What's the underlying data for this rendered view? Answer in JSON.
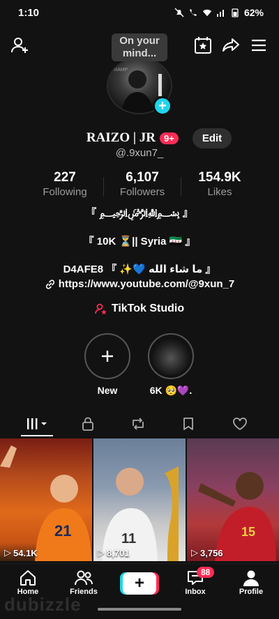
{
  "status": {
    "time": "1:10",
    "battery": "62%"
  },
  "topbar": {
    "mind_bubble": "On your mind..."
  },
  "profile": {
    "name": "RAIZO | JR",
    "name_badge": "9+",
    "edit_label": "Edit",
    "handle": "@.9xun7_"
  },
  "stats": [
    {
      "value": "227",
      "label": "Following"
    },
    {
      "value": "6,107",
      "label": "Followers"
    },
    {
      "value": "154.9K",
      "label": "Likes"
    }
  ],
  "bio": {
    "line1": "『 ﷽ 』",
    "line2": "『 10K ⏳|| Syria 🇸🇾 』",
    "line3": "D4AFE8 『 ✨💙 ما شاء الله 』",
    "link": "https://www.youtube.com/@9xun_7",
    "studio": "TikTok Studio"
  },
  "stories": [
    {
      "label": "New"
    },
    {
      "label": "6K 🥺💜."
    }
  ],
  "videos": [
    {
      "views": "54.1K"
    },
    {
      "views": "8,701"
    },
    {
      "views": "3,756"
    }
  ],
  "nav": {
    "home": "Home",
    "friends": "Friends",
    "inbox": "Inbox",
    "inbox_badge": "88",
    "profile": "Profile"
  },
  "watermark": "dubizzle",
  "colors": {
    "accent_red": "#fe2c55",
    "accent_cyan": "#20d5ec",
    "background": "#121212"
  }
}
